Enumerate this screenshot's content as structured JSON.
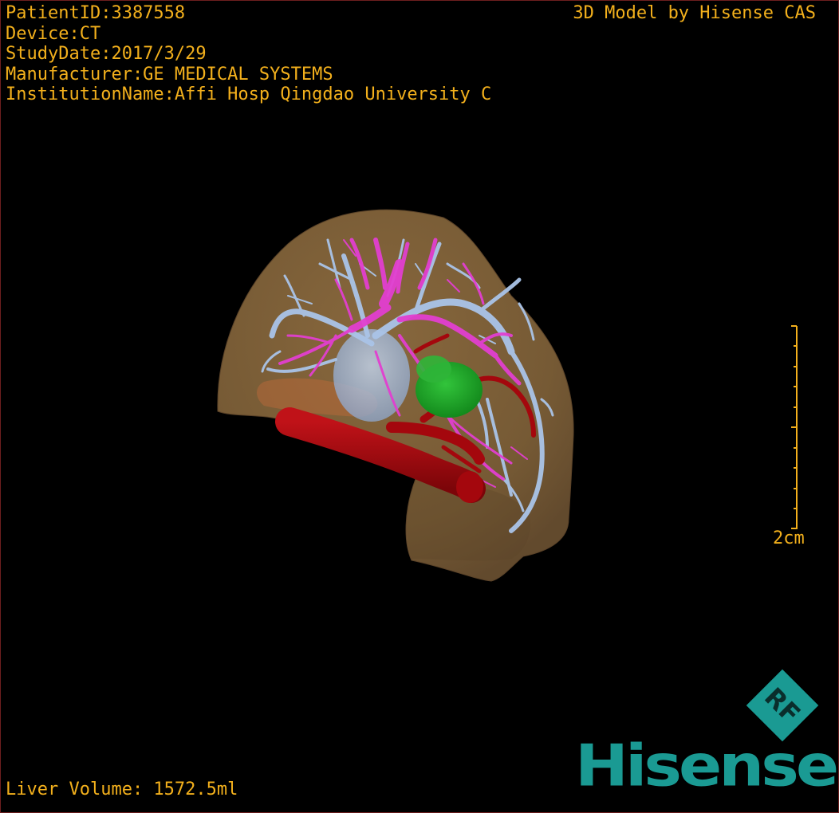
{
  "patient_info": {
    "patient_id": "PatientID:3387558",
    "device": "Device:CT",
    "study_date": "StudyDate:2017/3/29",
    "manufacturer": "Manufacturer:GE MEDICAL SYSTEMS",
    "institution": "InstitutionName:Affi Hosp Qingdao University C"
  },
  "model_credit": "3D Model by Hisense CAS",
  "scale_bar": {
    "label": "2cm"
  },
  "liver_volume": "Liver Volume: 1572.5ml",
  "logo": {
    "badge_text": "RF",
    "brand_text": "Hisense"
  },
  "colors": {
    "overlay_text": "#f3b01c",
    "liver_surface": "#8b6a3e",
    "hepatic_vein": "#aac4e8",
    "portal_vein": "#e23fd0",
    "artery": "#a4070d",
    "tumor": "#1ea52a",
    "brand": "#1a9a93"
  }
}
